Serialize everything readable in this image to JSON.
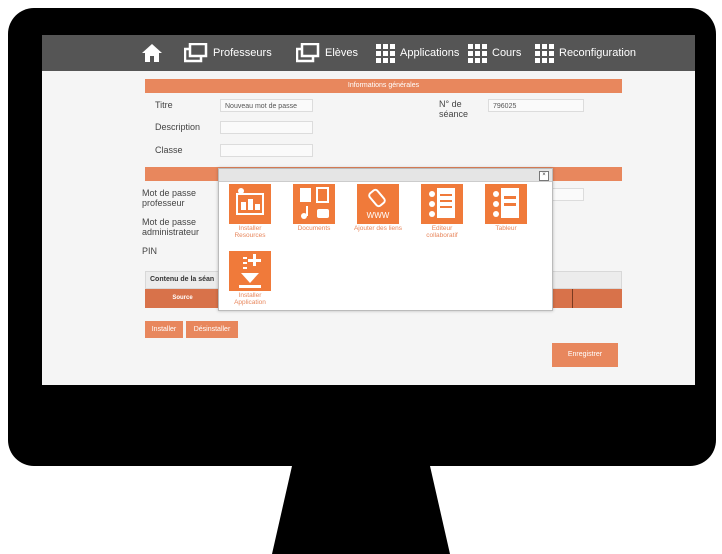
{
  "nav": {
    "home_icon": "home-icon",
    "items": [
      {
        "label": "Professeurs",
        "icon": "windows-icon"
      },
      {
        "label": "Elèves",
        "icon": "windows-icon"
      },
      {
        "label": "Applications",
        "icon": "grid-icon"
      },
      {
        "label": "Cours",
        "icon": "grid-icon"
      },
      {
        "label": "Reconfiguration",
        "icon": "grid-icon"
      }
    ]
  },
  "form": {
    "section1_title": "Informations générales",
    "titre_label": "Titre",
    "titre_value": "Nouveau mot de passe",
    "description_label": "Description",
    "description_value": "",
    "classe_label": "Classe",
    "classe_value": "",
    "seance_label": "N° de séance",
    "seance_value": "796025",
    "section2_title": "",
    "mdp_prof_label": "Mot de passe professeur",
    "mdp_admin_label": "Mot de passe administrateur",
    "pin_label": "PIN",
    "content_header": "Contenu de la séan",
    "table_source": "Source",
    "install_button": "Installer",
    "uninstall_button": "Désinstaller",
    "save_button": "Enregistrer"
  },
  "modal": {
    "close": "×",
    "tiles": [
      {
        "label": "Installer Resources",
        "icon": "install-resources-icon"
      },
      {
        "label": "Documents",
        "icon": "documents-icon"
      },
      {
        "label": "Ajouter des liens",
        "icon": "www-link-icon"
      },
      {
        "label": "Editeur collaboratif",
        "icon": "collaborative-editor-icon"
      },
      {
        "label": "Tableur",
        "icon": "spreadsheet-icon"
      },
      {
        "label": "Installer Application",
        "icon": "install-application-icon"
      }
    ]
  },
  "colors": {
    "accent": "#e8875d",
    "tile": "#f07a3a",
    "navbar": "#555555"
  }
}
